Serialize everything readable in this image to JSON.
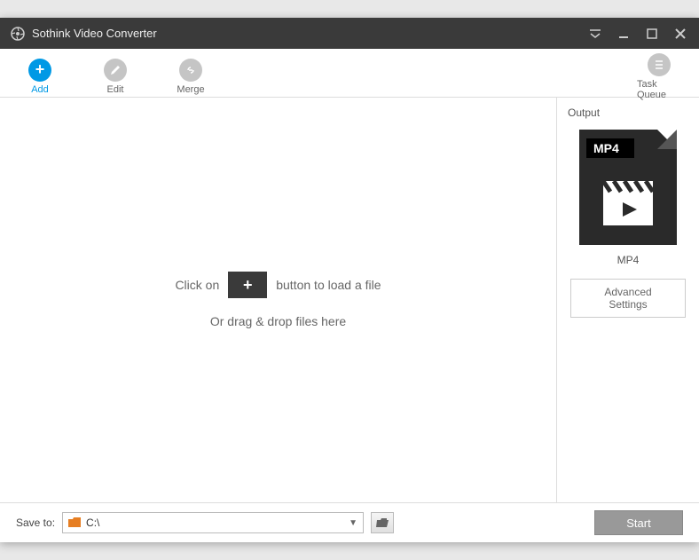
{
  "titlebar": {
    "app_name": "Sothink Video Converter"
  },
  "toolbar": {
    "add_label": "Add",
    "edit_label": "Edit",
    "merge_label": "Merge",
    "task_queue_label": "Task Queue"
  },
  "main": {
    "click_on": "Click on",
    "load_file": "button to load a file",
    "drag_drop": "Or drag & drop files here"
  },
  "output": {
    "header": "Output",
    "format_bar": "MP4",
    "format_label": "MP4",
    "advanced": "Advanced Settings"
  },
  "footer": {
    "save_to": "Save to:",
    "path": "C:\\",
    "start": "Start"
  }
}
